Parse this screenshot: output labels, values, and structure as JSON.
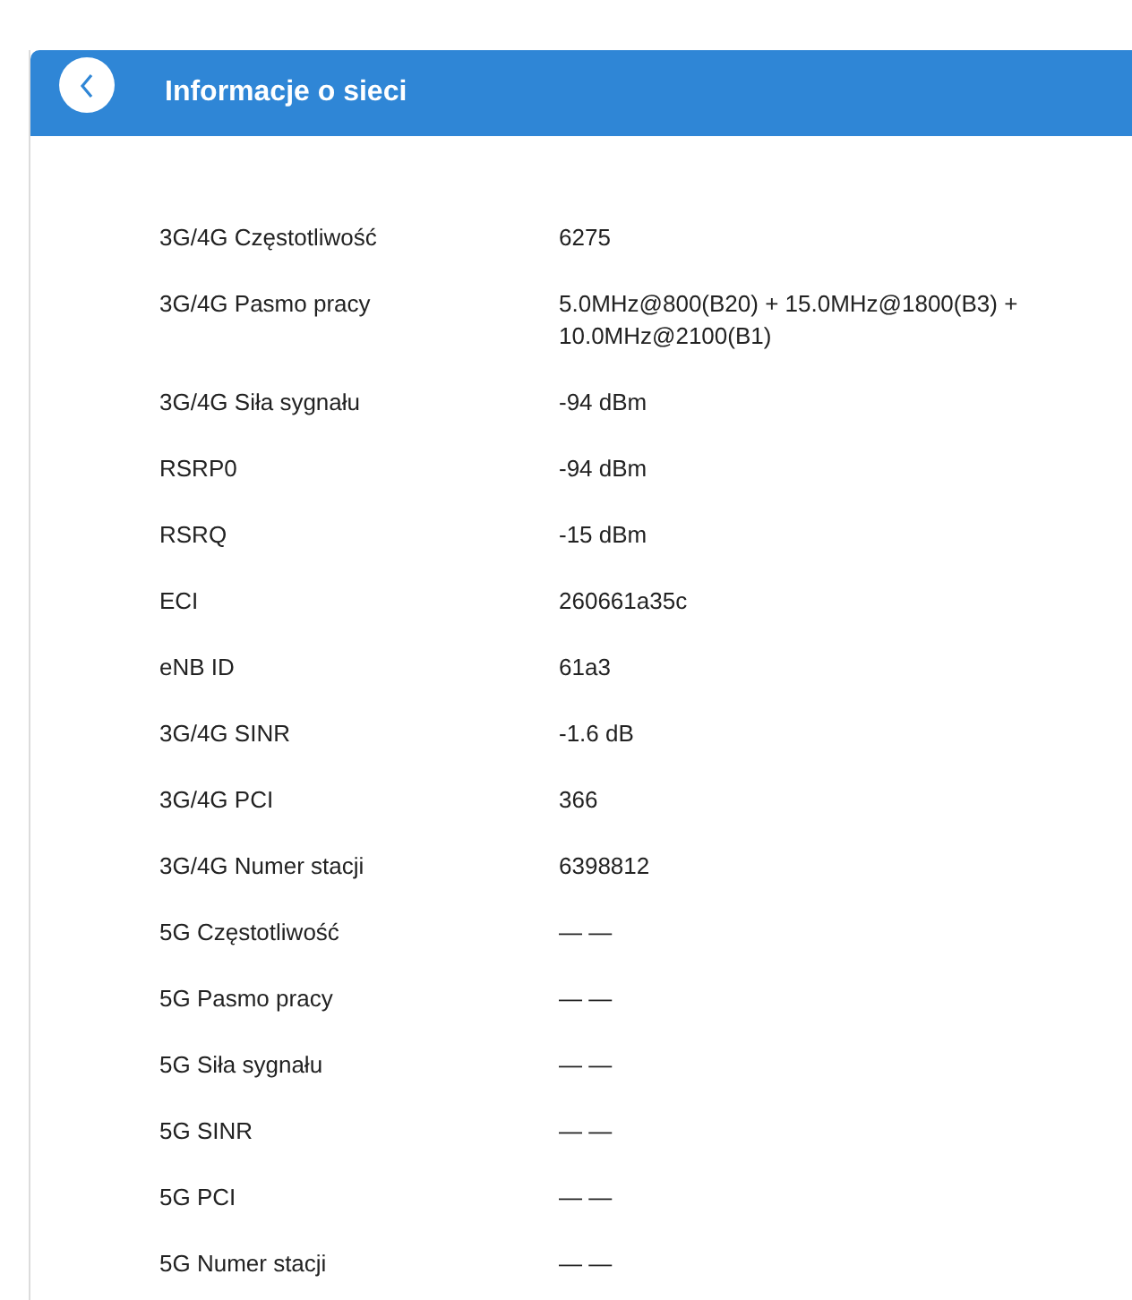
{
  "header": {
    "title": "Informacje o sieci"
  },
  "rows": [
    {
      "label": "3G/4G Częstotliwość",
      "value": "6275"
    },
    {
      "label": "3G/4G Pasmo pracy",
      "value": "5.0MHz@800(B20) + 15.0MHz@1800(B3) + 10.0MHz@2100(B1)"
    },
    {
      "label": "3G/4G Siła sygnału",
      "value": "-94 dBm"
    },
    {
      "label": "RSRP0",
      "value": "-94 dBm"
    },
    {
      "label": "RSRQ",
      "value": "-15 dBm"
    },
    {
      "label": "ECI",
      "value": "260661a35c"
    },
    {
      "label": "eNB ID",
      "value": "61a3"
    },
    {
      "label": "3G/4G SINR",
      "value": "-1.6 dB"
    },
    {
      "label": "3G/4G PCI",
      "value": "366"
    },
    {
      "label": "3G/4G Numer stacji",
      "value": "6398812"
    },
    {
      "label": "5G Częstotliwość",
      "value": "— —"
    },
    {
      "label": "5G Pasmo pracy",
      "value": "— —"
    },
    {
      "label": "5G Siła sygnału",
      "value": "— —"
    },
    {
      "label": "5G SINR",
      "value": "— —"
    },
    {
      "label": "5G PCI",
      "value": "— —"
    },
    {
      "label": "5G Numer stacji",
      "value": "— —"
    }
  ]
}
